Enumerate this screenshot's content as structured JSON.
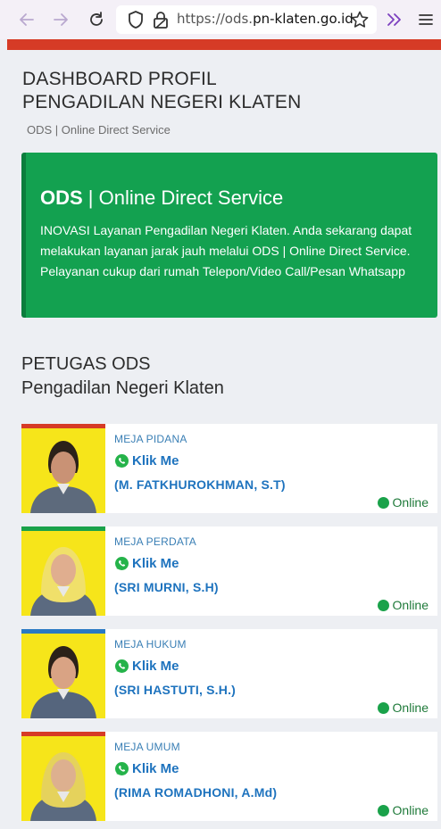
{
  "browser": {
    "url_prefix": "https://ods.",
    "url_host": "pn-klaten.go.id",
    "icons": [
      "back-icon",
      "forward-icon",
      "reload-icon",
      "shield-icon",
      "lock-icon",
      "star-icon",
      "extensions-icon",
      "menu-icon"
    ]
  },
  "header": {
    "title_line1": "DASHBOARD PROFIL",
    "title_line2": "PENGADILAN NEGERI KLATEN",
    "subtitle": "ODS | Online Direct Service"
  },
  "banner": {
    "title_bold": "ODS",
    "title_rest": " | Online Direct Service",
    "text": "INOVASI Layanan Pengadilan Negeri Klaten. Anda sekarang dapat melakukan layanan jarak jauh melalui ODS | Online Direct Service. Pelayanan cukup dari rumah Telepon/Video Call/Pesan Whatsapp",
    "color": "#13a150"
  },
  "section": {
    "title": "PETUGAS ODS",
    "subtitle": "Pengadilan Negeri Klaten"
  },
  "staff": [
    {
      "role": "MEJA PIDANA",
      "link": "Klik Me",
      "name": "(M. FATKHUROKHMAN, S.T)",
      "status": "Online",
      "accent": "#d63b26"
    },
    {
      "role": "MEJA PERDATA",
      "link": "Klik Me",
      "name": "(SRI MURNI, S.H)",
      "status": "Online",
      "accent": "#1aa24a"
    },
    {
      "role": "MEJA HUKUM",
      "link": "Klik Me",
      "name": "(SRI HASTUTI, S.H.)",
      "status": "Online",
      "accent": "#2a79c4"
    },
    {
      "role": "MEJA UMUM",
      "link": "Klik Me",
      "name": "(RIMA ROMADHONI, A.Md)",
      "status": "Online",
      "accent": "#d63b26"
    }
  ]
}
